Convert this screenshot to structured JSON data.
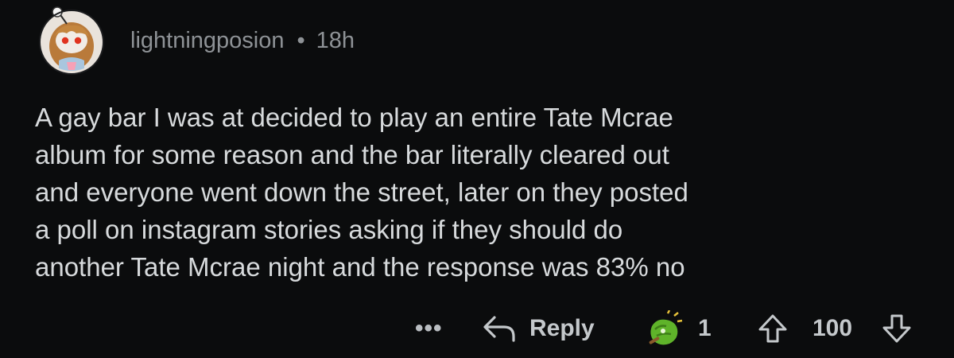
{
  "comment": {
    "username": "lightningposion",
    "separator": "•",
    "time_ago": "18h",
    "body_lines": [
      "A gay bar I was at decided to play an entire Tate Mcrae",
      "album for some reason and the bar literally cleared out",
      "and everyone went down the street,  later on they posted",
      "a poll on instagram stories asking if they should do",
      "another Tate Mcrae night and the response was 83% no"
    ]
  },
  "actions": {
    "more_label": "•••",
    "reply_label": "Reply",
    "award_count": "1",
    "score": "100"
  },
  "icons": {
    "avatar": "snoo-avatar-icon",
    "more": "more-options-icon",
    "reply": "reply-arrow-icon",
    "award": "award-icon",
    "upvote": "upvote-arrow-icon",
    "downvote": "downvote-arrow-icon"
  },
  "colors": {
    "background": "#0b0c0d",
    "text": "#d7dadc",
    "meta": "#8e9296",
    "award_green": "#5fb32a"
  }
}
